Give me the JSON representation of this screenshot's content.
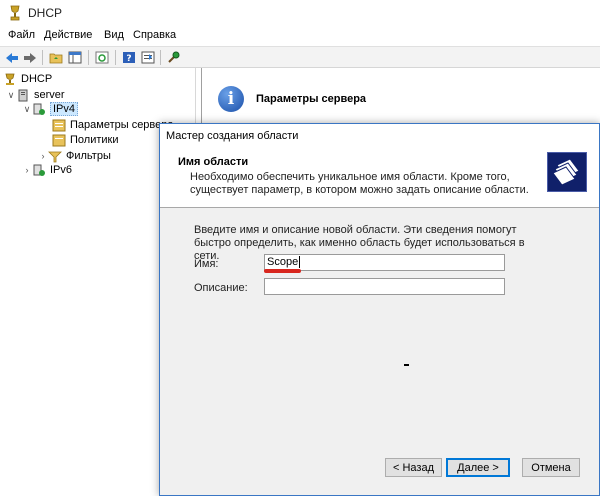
{
  "window": {
    "title": "DHCP"
  },
  "menu": [
    "Файл",
    "Действие",
    "Вид",
    "Справка"
  ],
  "toolbar_icons": [
    "back-icon",
    "forward-icon",
    "folder-up-icon",
    "console-tree-icon",
    "refresh-icon",
    "help-icon",
    "properties-icon",
    "options-icon"
  ],
  "tree": {
    "root": "DHCP",
    "server": "server",
    "ipv4": "IPv4",
    "server_options": "Параметры сервера",
    "policies": "Политики",
    "filters": "Фильтры",
    "ipv6": "IPv6"
  },
  "right_pane": {
    "title": "Параметры сервера"
  },
  "wizard": {
    "title": "Мастер создания области",
    "heading": "Имя области",
    "description": "Необходимо обеспечить уникальное имя области. Кроме того, существует параметр, в котором можно задать описание области.",
    "intro": "Введите имя и описание новой области. Эти сведения помогут быстро определить, как именно область будет использоваться в сети.",
    "name_label": "Имя:",
    "name_value": "Scope",
    "description_label": "Описание:",
    "description_value": "",
    "back_button": "< Назад",
    "next_button": "Далее >",
    "cancel_button": "Отмена"
  },
  "colors": {
    "selection": "#cce8ff",
    "dialog_border": "#3a76c4",
    "annotation_red": "#d8261e",
    "primary_button_border": "#0078d7"
  }
}
